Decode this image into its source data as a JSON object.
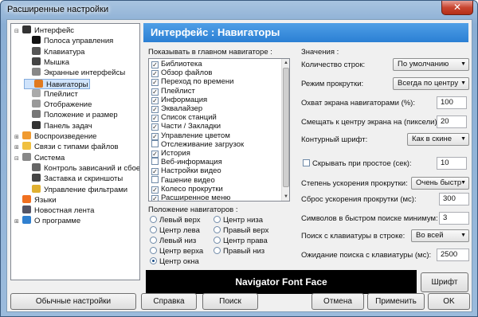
{
  "window": {
    "title": "Расширенные настройки",
    "close": "✕"
  },
  "tree": {
    "items": [
      {
        "label": "Интерфейс",
        "color": "#333",
        "expander": "⊟"
      },
      {
        "label": "Полоса управления",
        "color": "#111"
      },
      {
        "label": "Клавиатура",
        "color": "#555"
      },
      {
        "label": "Мышка",
        "color": "#444"
      },
      {
        "label": "Экранные интерфейсы",
        "color": "#888"
      },
      {
        "label": "Навигаторы",
        "color": "#e07a20"
      },
      {
        "label": "Плейлист",
        "color": "#aaa"
      },
      {
        "label": "Отображение",
        "color": "#999"
      },
      {
        "label": "Положение и размер",
        "color": "#777"
      },
      {
        "label": "Панель задач",
        "color": "#333"
      },
      {
        "label": "Воспроизведение",
        "color": "#f09a30",
        "expander": "⊞"
      },
      {
        "label": "Связи с типами файлов",
        "color": "#f0c040",
        "expander": "⊞"
      },
      {
        "label": "Система",
        "color": "#888",
        "expander": "⊟"
      },
      {
        "label": "Контроль зависаний и сбоев",
        "color": "#666"
      },
      {
        "label": "Заставка и скриншоты",
        "color": "#444"
      },
      {
        "label": "Управление фильтрами",
        "color": "#e0b030"
      },
      {
        "label": "Языки",
        "color": "#f07020"
      },
      {
        "label": "Новостная лента",
        "color": "#556"
      },
      {
        "label": "О программе",
        "color": "#3080d0",
        "expander": "⊞"
      }
    ]
  },
  "panel": {
    "header": "Интерфейс : Навигаторы",
    "show_group": "Показывать в главном навигаторе :",
    "show_items": [
      {
        "label": "Библиотека",
        "checked": true
      },
      {
        "label": "Обзор файлов",
        "checked": true
      },
      {
        "label": "Переход по времени",
        "checked": true
      },
      {
        "label": "Плейлист",
        "checked": true
      },
      {
        "label": "Информация",
        "checked": true
      },
      {
        "label": "Эквалайзер",
        "checked": true
      },
      {
        "label": "Список станций",
        "checked": true
      },
      {
        "label": "Части / Закладки",
        "checked": true
      },
      {
        "label": "Управление цветом",
        "checked": true
      },
      {
        "label": "Отслеживание загрузок",
        "checked": false
      },
      {
        "label": "История",
        "checked": true
      },
      {
        "label": "Веб-информация",
        "checked": false
      },
      {
        "label": "Настройки видео",
        "checked": true
      },
      {
        "label": "Гашение видео",
        "checked": false
      },
      {
        "label": "Колесо прокрутки",
        "checked": true
      },
      {
        "label": "Расширенное меню",
        "checked": true
      }
    ],
    "position_group": "Положение навигаторов :",
    "positions": [
      {
        "label": "Левый верх",
        "checked": false
      },
      {
        "label": "Центр низа",
        "checked": false
      },
      {
        "label": "Центр лева",
        "checked": false
      },
      {
        "label": "Правый верх",
        "checked": false
      },
      {
        "label": "Левый низ",
        "checked": false
      },
      {
        "label": "Центр права",
        "checked": false
      },
      {
        "label": "Центр верха",
        "checked": false
      },
      {
        "label": "Правый низ",
        "checked": false
      },
      {
        "label": "Центр окна",
        "checked": true
      }
    ],
    "values_group": "Значения :",
    "rows_label": "Количество строк:",
    "rows_value": "По умолчанию",
    "scroll_label": "Режим прокрутки:",
    "scroll_value": "Всегда по центру",
    "coverage_label": "Охват экрана навигаторами (%):",
    "coverage_value": "100",
    "offset_label": "Смещать к центру экрана на (пиксели):",
    "offset_value": "20",
    "outline_label": "Контурный шрифт:",
    "outline_value": "Как в скине",
    "hide_label": "Скрывать при простое (сек):",
    "hide_value": "10",
    "hide_checked": false,
    "accel_label": "Степень ускорения прокрутки:",
    "accel_value": "Очень быстр",
    "reset_label": "Сброс ускорения прокрутки (мс):",
    "reset_value": "300",
    "quick_label": "Символов в быстром поиске минимум:",
    "quick_value": "3",
    "kbsearch_label": "Поиск с клавиатуры в строке:",
    "kbsearch_value": "Во всей",
    "kbwait_label": "Ожидание поиска с клавиатуры (мс):",
    "kbwait_value": "2500",
    "font_face": "Navigator Font Face",
    "font_button": "Шрифт"
  },
  "buttons": {
    "normal": "Обычные настройки",
    "help": "Справка",
    "search": "Поиск",
    "cancel": "Отмена",
    "apply": "Применить",
    "ok": "OK"
  }
}
